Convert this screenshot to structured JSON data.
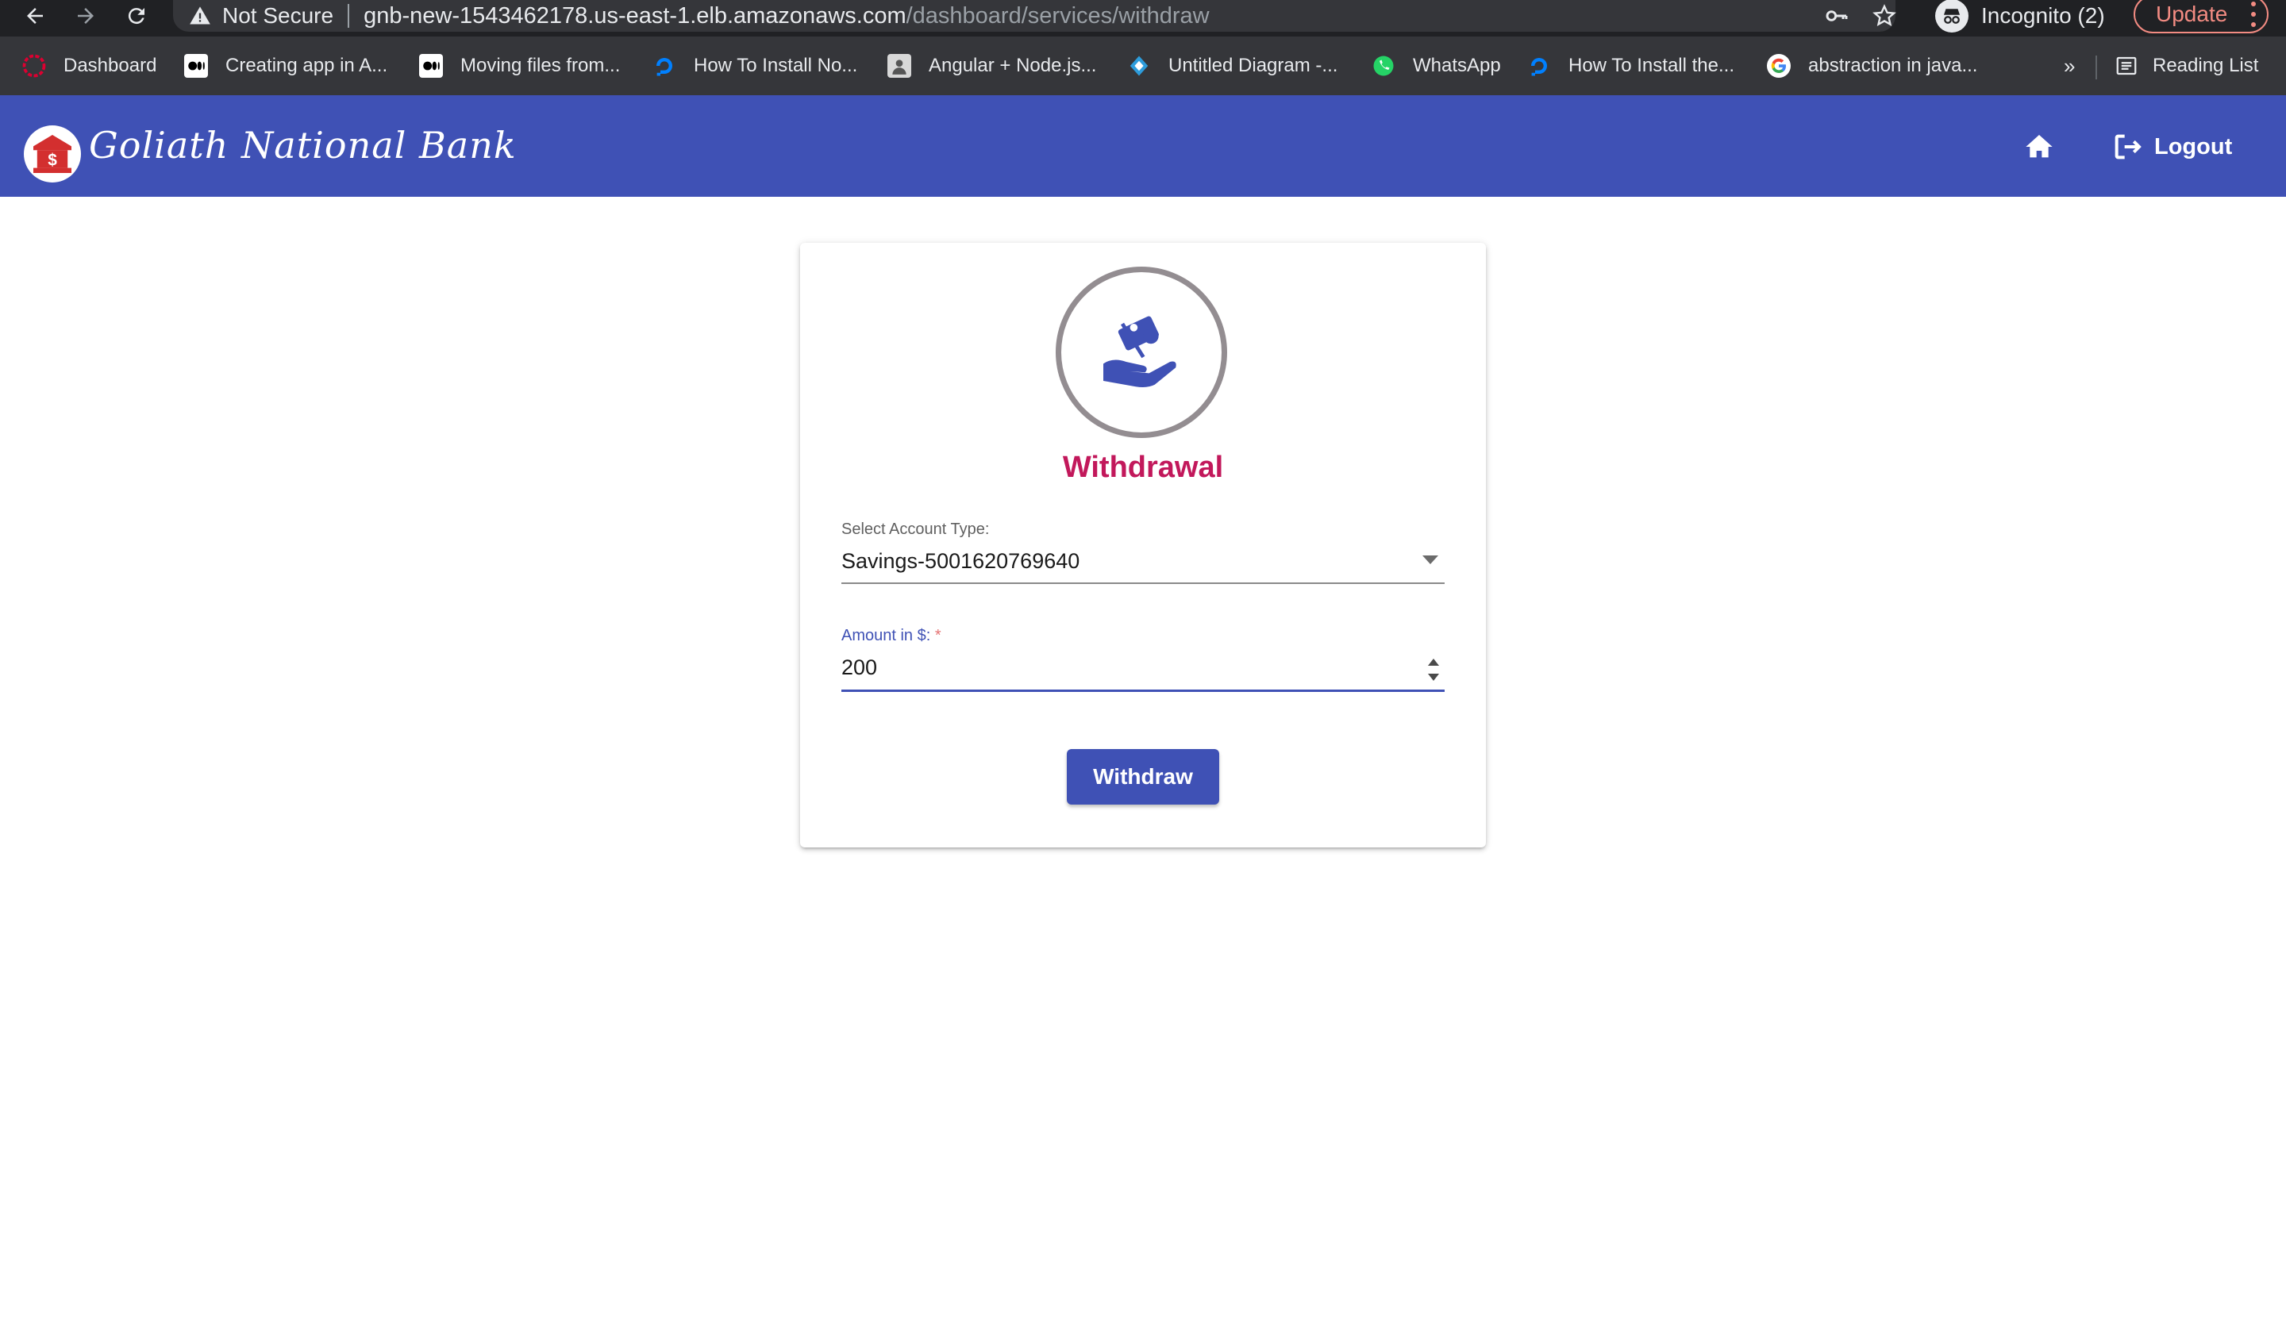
{
  "browser": {
    "security_text": "Not Secure",
    "url_host": "gnb-new-1543462178.us-east-1.elb.amazonaws.com",
    "url_path": "/dashboard/services/withdraw",
    "incognito_label": "Incognito (2)",
    "update_label": "Update",
    "bookmarks": [
      {
        "label": "Dashboard",
        "icon": "angular-icon"
      },
      {
        "label": "Creating app in A...",
        "icon": "medium-icon"
      },
      {
        "label": "Moving files from...",
        "icon": "medium-icon"
      },
      {
        "label": "How To Install No...",
        "icon": "digitalocean-icon"
      },
      {
        "label": "Angular + Node.js...",
        "icon": "avatar-icon"
      },
      {
        "label": "Untitled Diagram -...",
        "icon": "drawio-icon"
      },
      {
        "label": "WhatsApp",
        "icon": "whatsapp-icon"
      },
      {
        "label": "How To Install the...",
        "icon": "digitalocean-icon"
      },
      {
        "label": "abstraction in java...",
        "icon": "google-icon"
      }
    ],
    "more_label": "»",
    "reading_list_label": "Reading List"
  },
  "header": {
    "brand": "Goliath National Bank",
    "logout_label": "Logout"
  },
  "card": {
    "title": "Withdrawal",
    "account_label": "Select Account Type:",
    "account_value": "Savings-5001620769640",
    "amount_label": "Amount in $:",
    "amount_required": "*",
    "amount_value": "200",
    "submit_label": "Withdraw"
  },
  "colors": {
    "primary": "#3f51b5",
    "title_accent": "#c2185b",
    "chrome_dark": "#202124"
  }
}
